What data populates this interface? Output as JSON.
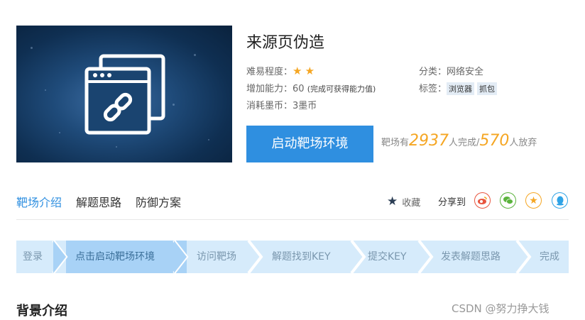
{
  "header": {
    "title": "来源页伪造",
    "difficulty_label": "难易程度：",
    "difficulty_stars": 2,
    "ability_label": "增加能力：",
    "ability_value": "60",
    "ability_note": "(完成可获得能力值)",
    "cost_label": "消耗墨币：",
    "cost_value": "3墨币",
    "category_label": "分类：",
    "category_value": "网络安全",
    "tags_label": "标签：",
    "tags": [
      "浏览器",
      "抓包"
    ]
  },
  "start_button": {
    "label": "启动靶场环境"
  },
  "stats": {
    "prefix": "靶场有",
    "completed": "2937",
    "completed_suffix": "人完成/",
    "abandoned": "570",
    "abandoned_suffix": "人放弃"
  },
  "tabs": [
    {
      "label": "靶场介绍",
      "active": true
    },
    {
      "label": "解题思路",
      "active": false
    },
    {
      "label": "防御方案",
      "active": false
    }
  ],
  "favorite": {
    "label": "收藏"
  },
  "share": {
    "label": "分享到",
    "icons": [
      "weibo-icon",
      "wechat-icon",
      "qzone-icon",
      "qq-icon"
    ]
  },
  "steps": [
    {
      "label": "登录"
    },
    {
      "label": "点击启动靶场环境",
      "active": true
    },
    {
      "label": "访问靶场"
    },
    {
      "label": "解题找到KEY"
    },
    {
      "label": "提交KEY"
    },
    {
      "label": "发表解题思路"
    },
    {
      "label": "完成"
    }
  ],
  "section": {
    "title": "背景介绍"
  },
  "watermark": {
    "text": "CSDN @努力挣大钱"
  },
  "colors": {
    "accent": "#2f8fe0",
    "star": "#f5a623",
    "step_bg": "#d6ebfb",
    "step_active_bg": "#a8d2f6"
  }
}
